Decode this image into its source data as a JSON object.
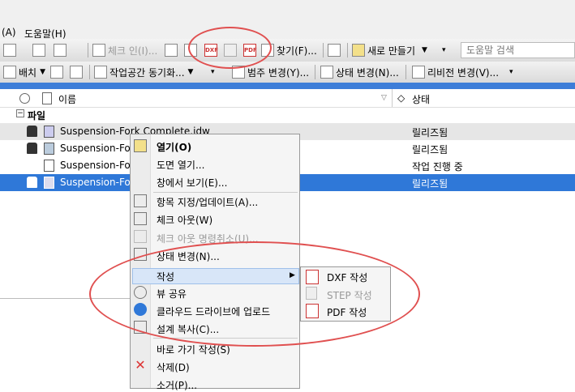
{
  "menubar": {
    "item_a": "(A)",
    "help": "도움말(H)"
  },
  "toolbar1": {
    "checkin": "체크 인(I)...",
    "find": "찾기(F)...",
    "new": "새로 만들기",
    "search_placeholder": "도움말 검색",
    "dxf_label": "DXF",
    "pdf_label": "PDF"
  },
  "toolbar2": {
    "layout": "배치",
    "sync": "작업공간 동기화...",
    "category": "범주 변경(Y)...",
    "state": "상태 변경(N)...",
    "revision": "리비전 변경(V)..."
  },
  "columns": {
    "name": "이름",
    "state": "상태"
  },
  "group_label": "파일",
  "rows": [
    {
      "name": "Suspension-Fork Complete.idw",
      "state": "릴리즈됨"
    },
    {
      "name": "Suspension-Fork",
      "state": "릴리즈됨"
    },
    {
      "name": "Suspension-Fork",
      "state": "작업 진행 중"
    },
    {
      "name": "Suspension-Fork",
      "state": "릴리즈됨"
    }
  ],
  "context_menu": {
    "open": "열기(O)",
    "open_drawing": "도면 열기...",
    "view_in_window": "창에서 보기(E)...",
    "assign_update": "항목 지정/업데이트(A)...",
    "checkout": "체크 아웃(W)",
    "undo_checkout": "체크 아웃 명령취소(U)...",
    "change_state": "상태 변경(N)...",
    "create": "작성",
    "share_view": "뷰 공유",
    "upload_cloud": "클라우드 드라이브에 업로드",
    "copy_design": "설계 복사(C)...",
    "create_shortcut": "바로 가기 작성(S)",
    "delete": "삭제(D)",
    "remove": "소거(P)..."
  },
  "submenu": {
    "dxf": "DXF 작성",
    "step": "STEP 작성",
    "pdf": "PDF 작성"
  },
  "colors": {
    "selection": "#2f78d8",
    "annotation": "#e05050"
  }
}
